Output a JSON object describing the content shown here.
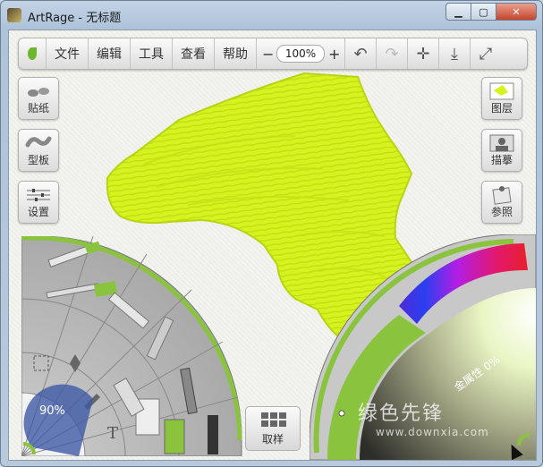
{
  "window": {
    "title": "ArtRage - 无标题",
    "controls": {
      "minimize": "▁",
      "maximize": "▢",
      "close": "✕"
    }
  },
  "toolbar": {
    "menus": [
      "文件",
      "编辑",
      "工具",
      "查看",
      "帮助"
    ],
    "zoom": {
      "minus": "−",
      "value": "100%",
      "plus": "+"
    },
    "icons": [
      {
        "name": "undo-icon",
        "glyph": "↶",
        "enabled": true
      },
      {
        "name": "redo-icon",
        "glyph": "↷",
        "enabled": false
      },
      {
        "name": "rotate-canvas-icon",
        "glyph": "✛",
        "enabled": true
      },
      {
        "name": "download-icon",
        "glyph": "⤓",
        "enabled": true
      },
      {
        "name": "fullscreen-icon",
        "glyph": "⤢",
        "enabled": true
      }
    ]
  },
  "left_panels": {
    "stickers": "贴纸",
    "stencils": "型板",
    "settings": "设置"
  },
  "right_panels": {
    "layers": "图层",
    "tracing": "描摹",
    "references": "参照"
  },
  "tool_wheel": {
    "percent": "90%",
    "text_tool": "T"
  },
  "sample_button": {
    "label": "取样"
  },
  "color_picker": {
    "metallic_label": "金属性 0%"
  },
  "colors": {
    "paint": "#d7f21e",
    "paint_shadow": "#b7d010",
    "accent": "#8ac43f",
    "wheel_dark": "#3b3b36"
  },
  "watermark": {
    "text": "绿色先锋",
    "url": "www.downxia.com"
  }
}
